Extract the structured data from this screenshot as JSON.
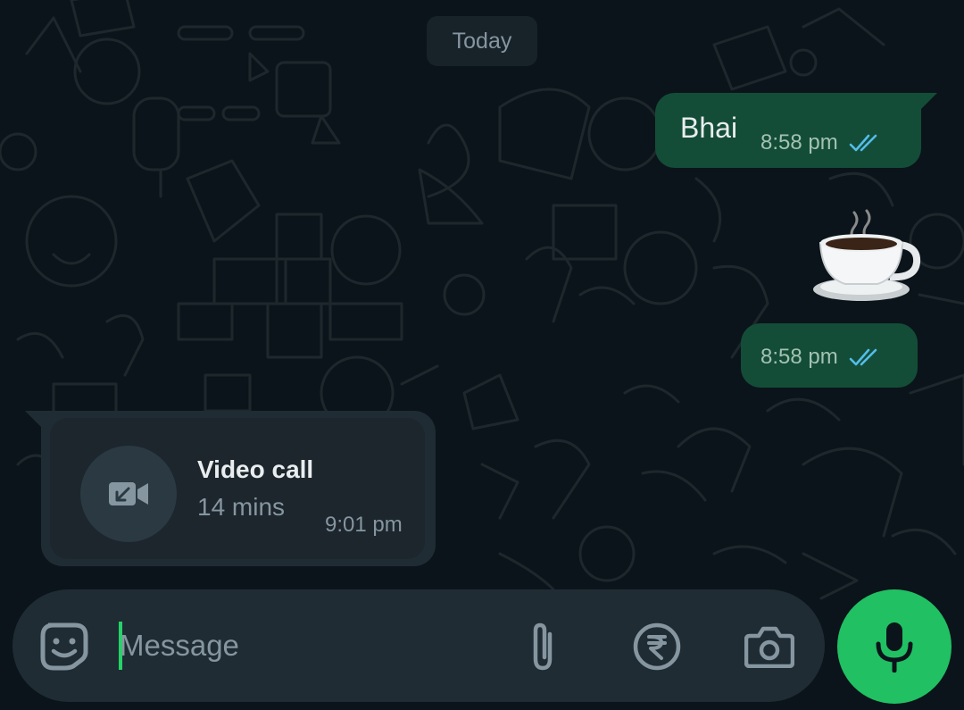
{
  "date_separator": "Today",
  "messages": [
    {
      "text": "Bhai",
      "time": "8:58 pm"
    },
    {
      "sticker": "hot-coffee-cup-emoji",
      "time": "8:58 pm"
    }
  ],
  "call": {
    "title": "Video call",
    "duration": "14 mins",
    "time": "9:01 pm"
  },
  "composer": {
    "placeholder": "Message"
  },
  "icons": {
    "emoji": "sticker-smile-icon",
    "attach": "paperclip-icon",
    "payment": "rupee-icon",
    "camera": "camera-icon",
    "send": "mic-icon",
    "call": "incoming-video-call-icon",
    "status": "double-check-read-icon"
  },
  "colors": {
    "background": "#0b141a",
    "outgoing_bubble": "#144d37",
    "incoming_bubble": "#202c33",
    "accent": "#21c063",
    "read_ticks": "#53bdeb"
  }
}
